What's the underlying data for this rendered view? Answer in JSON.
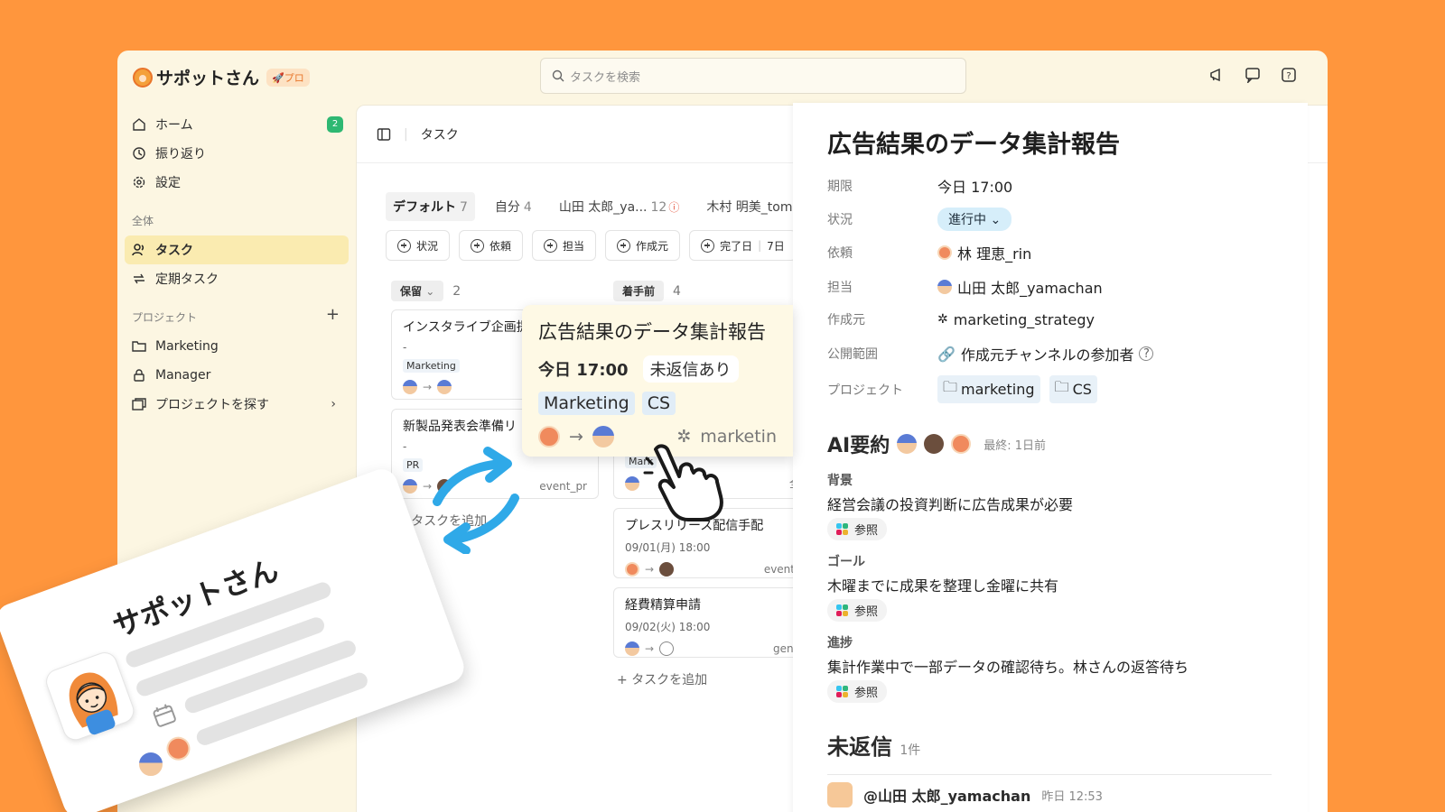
{
  "app": {
    "name": "サポットさん",
    "plan_badge": "🚀プロ"
  },
  "search": {
    "placeholder": "タスクを検索"
  },
  "sidebar": {
    "items": [
      {
        "label": "ホーム",
        "badge": "2"
      },
      {
        "label": "振り返り"
      },
      {
        "label": "設定"
      }
    ],
    "section_all": "全体",
    "all_items": [
      {
        "label": "タスク"
      },
      {
        "label": "定期タスク"
      }
    ],
    "section_projects": "プロジェクト",
    "projects": [
      {
        "label": "Marketing"
      },
      {
        "label": "Manager"
      },
      {
        "label": "プロジェクトを探す"
      }
    ]
  },
  "main": {
    "title": "タスク",
    "tabs": [
      {
        "label": "デフォルト",
        "count": "7"
      },
      {
        "label": "自分",
        "count": "4"
      },
      {
        "label": "山田 太郎_ya...",
        "count": "12"
      },
      {
        "label": "木村 明美_tom"
      }
    ],
    "filters": [
      "状況",
      "依頼",
      "担当",
      "作成元",
      "完了日"
    ],
    "filter_extra": "7日",
    "columns": [
      {
        "label": "保留",
        "count": "2"
      },
      {
        "label": "着手前",
        "count": "4"
      }
    ],
    "cards_left": [
      {
        "title": "インスタライブ企画提",
        "sub": "-",
        "tag": "Marketing"
      },
      {
        "title": "新製品発表会準備リ",
        "sub": "-",
        "tag": "PR",
        "channel": "event_pr"
      }
    ],
    "cards_right": [
      {
        "title": "",
        "tag": "Mark",
        "channel": "全"
      },
      {
        "title": "プレスリリース配信手配",
        "sub": "09/01(月) 18:00",
        "channel": "event_"
      },
      {
        "title": "経費精算申請",
        "sub": "09/02(火) 18:00",
        "channel": "gene"
      }
    ],
    "add_task": "タスクを追加"
  },
  "popup": {
    "title": "広告結果のデータ集計報告",
    "due": "今日 17:00",
    "unreplied": "未返信あり",
    "tags": [
      "Marketing",
      "CS"
    ],
    "channel": "marketin"
  },
  "detail": {
    "title": "広告結果のデータ集計報告",
    "props": [
      {
        "key": "期限",
        "value": "今日 17:00"
      },
      {
        "key": "状況",
        "value": "進行中"
      },
      {
        "key": "依頼",
        "value": "林 理恵_rin"
      },
      {
        "key": "担当",
        "value": "山田 太郎_yamachan"
      },
      {
        "key": "作成元",
        "value": "marketing_strategy"
      },
      {
        "key": "公開範囲",
        "value": "作成元チャンネルの参加者"
      },
      {
        "key": "プロジェクト",
        "tags": [
          "marketing",
          "CS"
        ]
      }
    ],
    "ai_title": "AI要約",
    "ai_last": "最終: 1日前",
    "sections": [
      {
        "head": "背景",
        "body": "経営会議の投資判断に広告成果が必要"
      },
      {
        "head": "ゴール",
        "body": "木曜までに成果を整理し金曜に共有"
      },
      {
        "head": "進捗",
        "body": "集計作業中で一部データの確認待ち。林さんの返答待ち"
      }
    ],
    "ref_label": "参照",
    "unreplied_title": "未返信",
    "unreplied_count": "1件",
    "reply": {
      "user": "@山田 太郎_yamachan",
      "time": "昨日 12:53"
    }
  },
  "promo": {
    "title": "サポットさん"
  },
  "colors": {
    "background": "#FF963D",
    "accent": "#2EB872",
    "active_nav": "#FAEBB0",
    "status": "#D6EEFA"
  }
}
